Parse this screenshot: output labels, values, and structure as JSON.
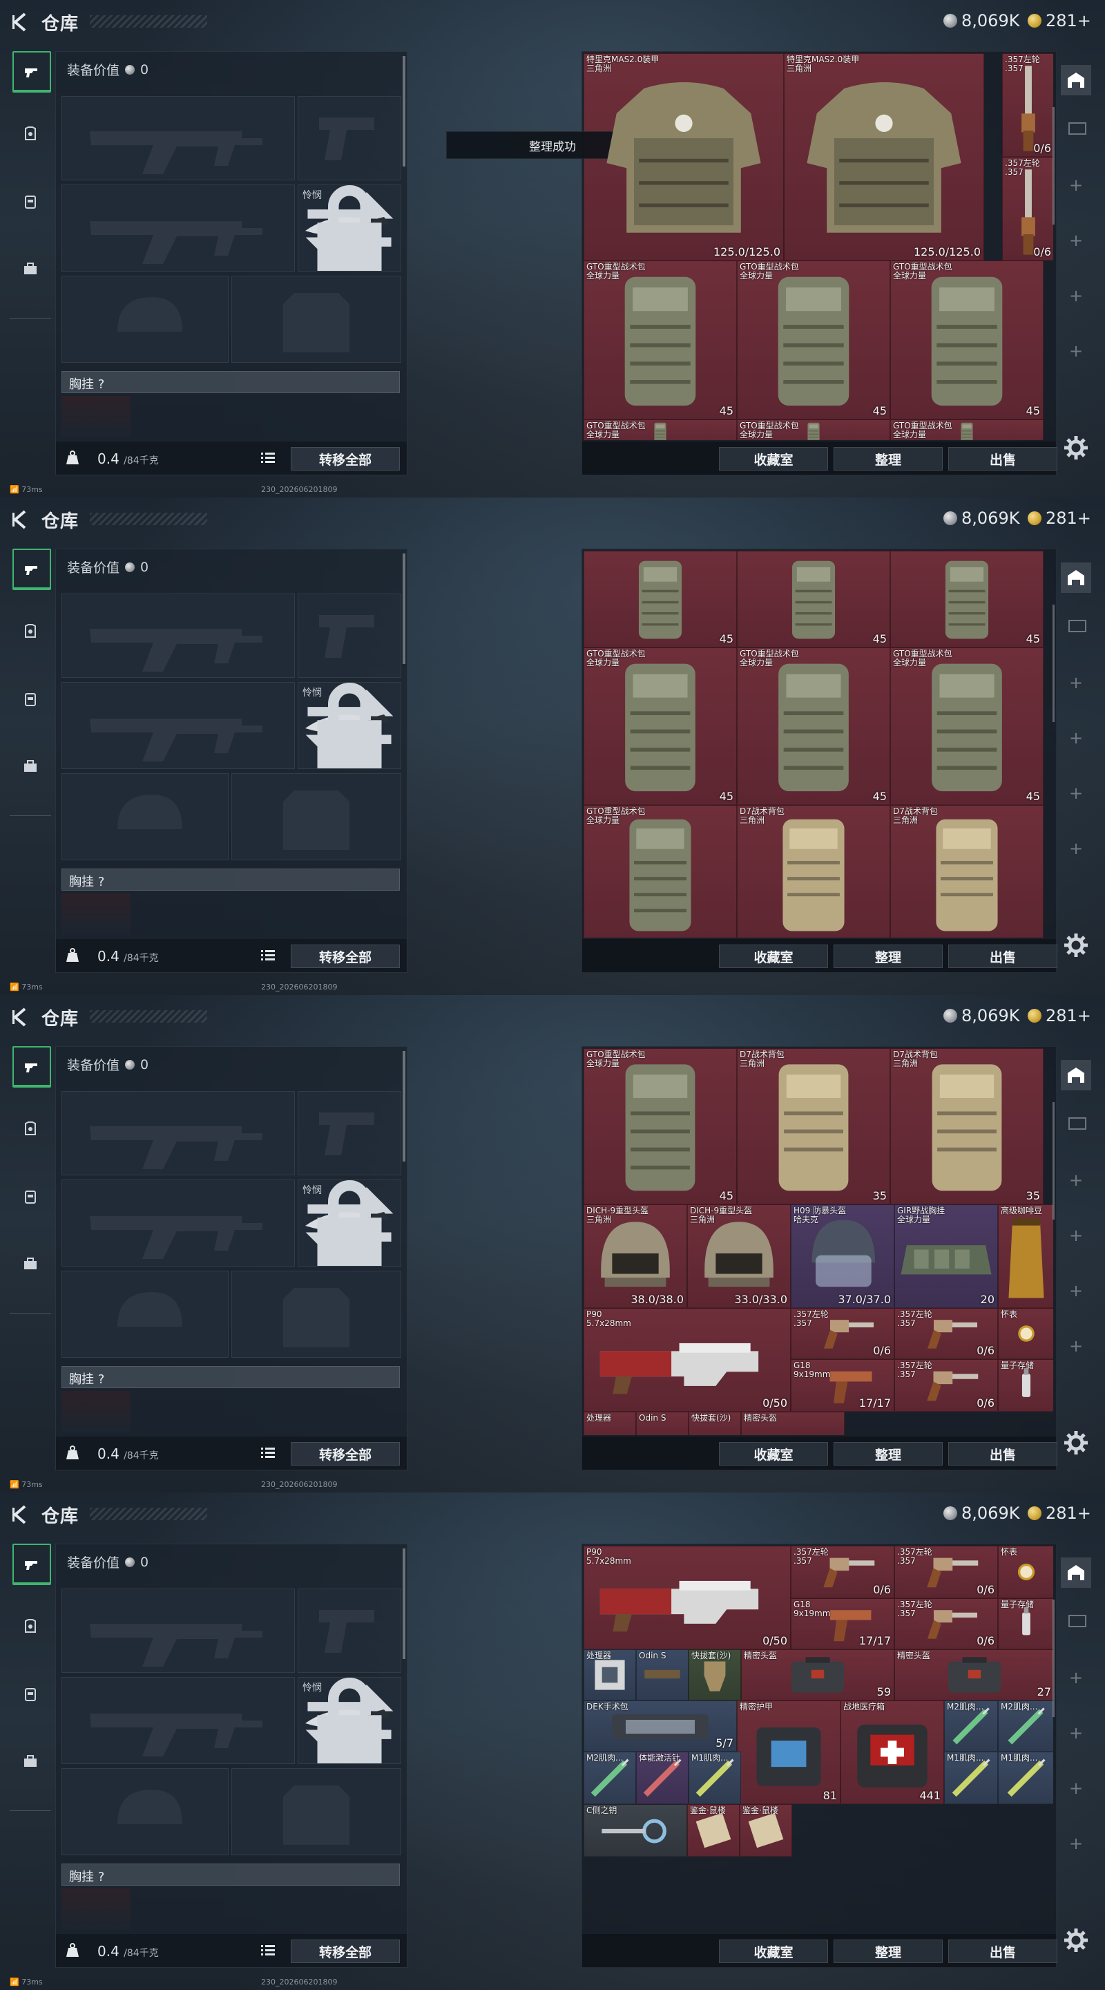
{
  "header": {
    "title": "仓库",
    "silver": "8,069K",
    "gold": "281+"
  },
  "loadout": {
    "equip_value_label": "装备价值",
    "equip_value": "0",
    "melee_label": "怜悯",
    "chest_label": "胸挂 ?",
    "weight_current": "0.4",
    "weight_max": "/84千克",
    "transfer_all": "转移全部"
  },
  "toast": "整理成功",
  "stash": {
    "buttons": {
      "collection": "收藏室",
      "sort": "整理",
      "sell": "出售"
    },
    "frames": [
      {
        "items": [
          {
            "name": "特里克MAS2.0装甲\n三角洲",
            "val": "125.0/125.0",
            "c": "red",
            "art": "armor"
          },
          {
            "name": "特里克MAS2.0装甲\n三角洲",
            "val": "125.0/125.0",
            "c": "red",
            "art": "armor"
          },
          {
            "name": ".357左轮\n.357",
            "val": "0/6",
            "c": "red",
            "art": "revolver-v"
          },
          {
            "name": ".357左轮\n.357",
            "val": "0/6",
            "c": "red",
            "art": "revolver-v"
          },
          {
            "name": "GTO重型战术包\n全球力量",
            "val": "45",
            "c": "red",
            "art": "pack"
          },
          {
            "name": "GTO重型战术包\n全球力量",
            "val": "45",
            "c": "red",
            "art": "pack"
          },
          {
            "name": "GTO重型战术包\n全球力量",
            "val": "45",
            "c": "red",
            "art": "pack"
          },
          {
            "name": "GTO重型战术包\n全球力量",
            "val": "",
            "c": "red",
            "art": "pack"
          },
          {
            "name": "GTO重型战术包\n全球力量",
            "val": "",
            "c": "red",
            "art": "pack"
          },
          {
            "name": "GTO重型战术包\n全球力量",
            "val": "",
            "c": "red",
            "art": "pack"
          }
        ]
      },
      {
        "items": [
          {
            "name": "",
            "val": "45",
            "c": "red",
            "art": "pack"
          },
          {
            "name": "",
            "val": "45",
            "c": "red",
            "art": "pack"
          },
          {
            "name": "",
            "val": "45",
            "c": "red",
            "art": "pack"
          },
          {
            "name": "GTO重型战术包\n全球力量",
            "val": "45",
            "c": "red",
            "art": "pack"
          },
          {
            "name": "GTO重型战术包\n全球力量",
            "val": "45",
            "c": "red",
            "art": "pack"
          },
          {
            "name": "GTO重型战术包\n全球力量",
            "val": "45",
            "c": "red",
            "art": "pack"
          },
          {
            "name": "GTO重型战术包\n全球力量",
            "val": "",
            "c": "red",
            "art": "pack"
          },
          {
            "name": "D7战术背包\n三角洲",
            "val": "",
            "c": "red",
            "art": "pack-tan"
          },
          {
            "name": "D7战术背包\n三角洲",
            "val": "",
            "c": "red",
            "art": "pack-tan"
          }
        ]
      },
      {
        "items": [
          {
            "name": "GTO重型战术包\n全球力量",
            "val": "45",
            "c": "red",
            "art": "pack"
          },
          {
            "name": "D7战术背包\n三角洲",
            "val": "35",
            "c": "red",
            "art": "pack-tan"
          },
          {
            "name": "D7战术背包\n三角洲",
            "val": "35",
            "c": "red",
            "art": "pack-tan"
          },
          {
            "name": "DICH-9重型头盔\n三角洲",
            "val": "38.0/38.0",
            "c": "red",
            "art": "helmet"
          },
          {
            "name": "DICH-9重型头盔\n三角洲",
            "val": "33.0/33.0",
            "c": "red",
            "art": "helmet"
          },
          {
            "name": "H09 防暴头盔\n哈夫克",
            "val": "37.0/37.0",
            "c": "purple",
            "art": "riot"
          },
          {
            "name": "GIR野战胸挂\n全球力量",
            "val": "20",
            "c": "purple",
            "art": "rig"
          },
          {
            "name": "高级咖啡豆",
            "val": "",
            "c": "red",
            "art": "coffee"
          },
          {
            "name": "P90\n5.7x28mm",
            "val": "0/50",
            "c": "red",
            "art": "p90"
          },
          {
            "name": ".357左轮\n.357",
            "val": "0/6",
            "c": "red",
            "art": "revolver"
          },
          {
            "name": ".357左轮\n.357",
            "val": "0/6",
            "c": "red",
            "art": "revolver"
          },
          {
            "name": "怀表",
            "val": "",
            "c": "red",
            "art": "watch"
          },
          {
            "name": "G18\n9x19mm",
            "val": "17/17",
            "c": "red",
            "art": "pistol"
          },
          {
            "name": ".357左轮\n.357",
            "val": "0/6",
            "c": "red",
            "art": "revolver"
          },
          {
            "name": "量子存储",
            "val": "",
            "c": "red",
            "art": "usb"
          },
          {
            "name": "处理器",
            "val": "",
            "c": "red",
            "art": ""
          },
          {
            "name": "Odin S",
            "val": "",
            "c": "red",
            "art": ""
          },
          {
            "name": "快拔套(沙)",
            "val": "",
            "c": "red",
            "art": ""
          },
          {
            "name": "精密头盔",
            "val": "",
            "c": "red",
            "art": ""
          }
        ]
      },
      {
        "items": [
          {
            "name": "P90\n5.7x28mm",
            "val": "0/50",
            "c": "red",
            "art": "p90"
          },
          {
            "name": ".357左轮\n.357",
            "val": "0/6",
            "c": "red",
            "art": "revolver"
          },
          {
            "name": ".357左轮\n.357",
            "val": "0/6",
            "c": "red",
            "art": "revolver"
          },
          {
            "name": "怀表",
            "val": "",
            "c": "red",
            "art": "watch"
          },
          {
            "name": "G18\n9x19mm",
            "val": "17/17",
            "c": "red",
            "art": "pistol"
          },
          {
            "name": ".357左轮\n.357",
            "val": "0/6",
            "c": "red",
            "art": "revolver"
          },
          {
            "name": "量子存储",
            "val": "",
            "c": "red",
            "art": "usb"
          },
          {
            "name": "处理器",
            "val": "",
            "c": "blue",
            "art": "processor"
          },
          {
            "name": "Odin S",
            "val": "",
            "c": "blue",
            "art": "scope"
          },
          {
            "name": "快拔套(沙)",
            "val": "",
            "c": "green",
            "art": "holster"
          },
          {
            "name": "精密头盔",
            "val": "59",
            "c": "red",
            "art": "case"
          },
          {
            "name": "精密头盔",
            "val": "27",
            "c": "red",
            "art": "case"
          },
          {
            "name": "DEK手术包",
            "val": "5/7",
            "c": "blue",
            "art": "surgery"
          },
          {
            "name": "精密护甲",
            "val": "81",
            "c": "red",
            "art": "case-blue"
          },
          {
            "name": "战地医疗箱",
            "val": "441",
            "c": "red",
            "art": "medkit"
          },
          {
            "name": "M2肌肉...",
            "val": "",
            "c": "blue",
            "art": "syringe-g"
          },
          {
            "name": "M2肌肉...",
            "val": "",
            "c": "blue",
            "art": "syringe-g"
          },
          {
            "name": "M2肌肉...",
            "val": "",
            "c": "blue",
            "art": "syringe-g"
          },
          {
            "name": "体能激活针",
            "val": "",
            "c": "purple",
            "art": "syringe-r"
          },
          {
            "name": "M1肌肉...",
            "val": "",
            "c": "blue",
            "art": "syringe-y"
          },
          {
            "name": "M1肌肉...",
            "val": "",
            "c": "blue",
            "art": "syringe-y"
          },
          {
            "name": "M1肌肉...",
            "val": "",
            "c": "blue",
            "art": "syringe-y"
          },
          {
            "name": "C侧之钥",
            "val": "",
            "c": "gray",
            "art": "key"
          },
          {
            "name": "鉴金·鼠楼",
            "val": "",
            "c": "red",
            "art": "card"
          },
          {
            "name": "鉴金·鼠楼",
            "val": "",
            "c": "red",
            "art": "card"
          }
        ]
      }
    ]
  },
  "footer": {
    "ping": "73ms",
    "build": "230_202606201809"
  },
  "icons": [
    "back-arrow-icon",
    "silver-coin-icon",
    "gold-coin-icon",
    "gun-tab-icon",
    "armor-tab-icon",
    "backpack-tab-icon",
    "case-tab-icon",
    "weight-icon",
    "list-icon",
    "swap-icon",
    "lock-icon",
    "stash-icon",
    "settings-gear-icon"
  ],
  "colors": {
    "accent_green": "#3fb56e",
    "rarity_red": "#6e2f3a",
    "rarity_blue": "#3b4a63",
    "rarity_purple": "#4c3b63"
  }
}
